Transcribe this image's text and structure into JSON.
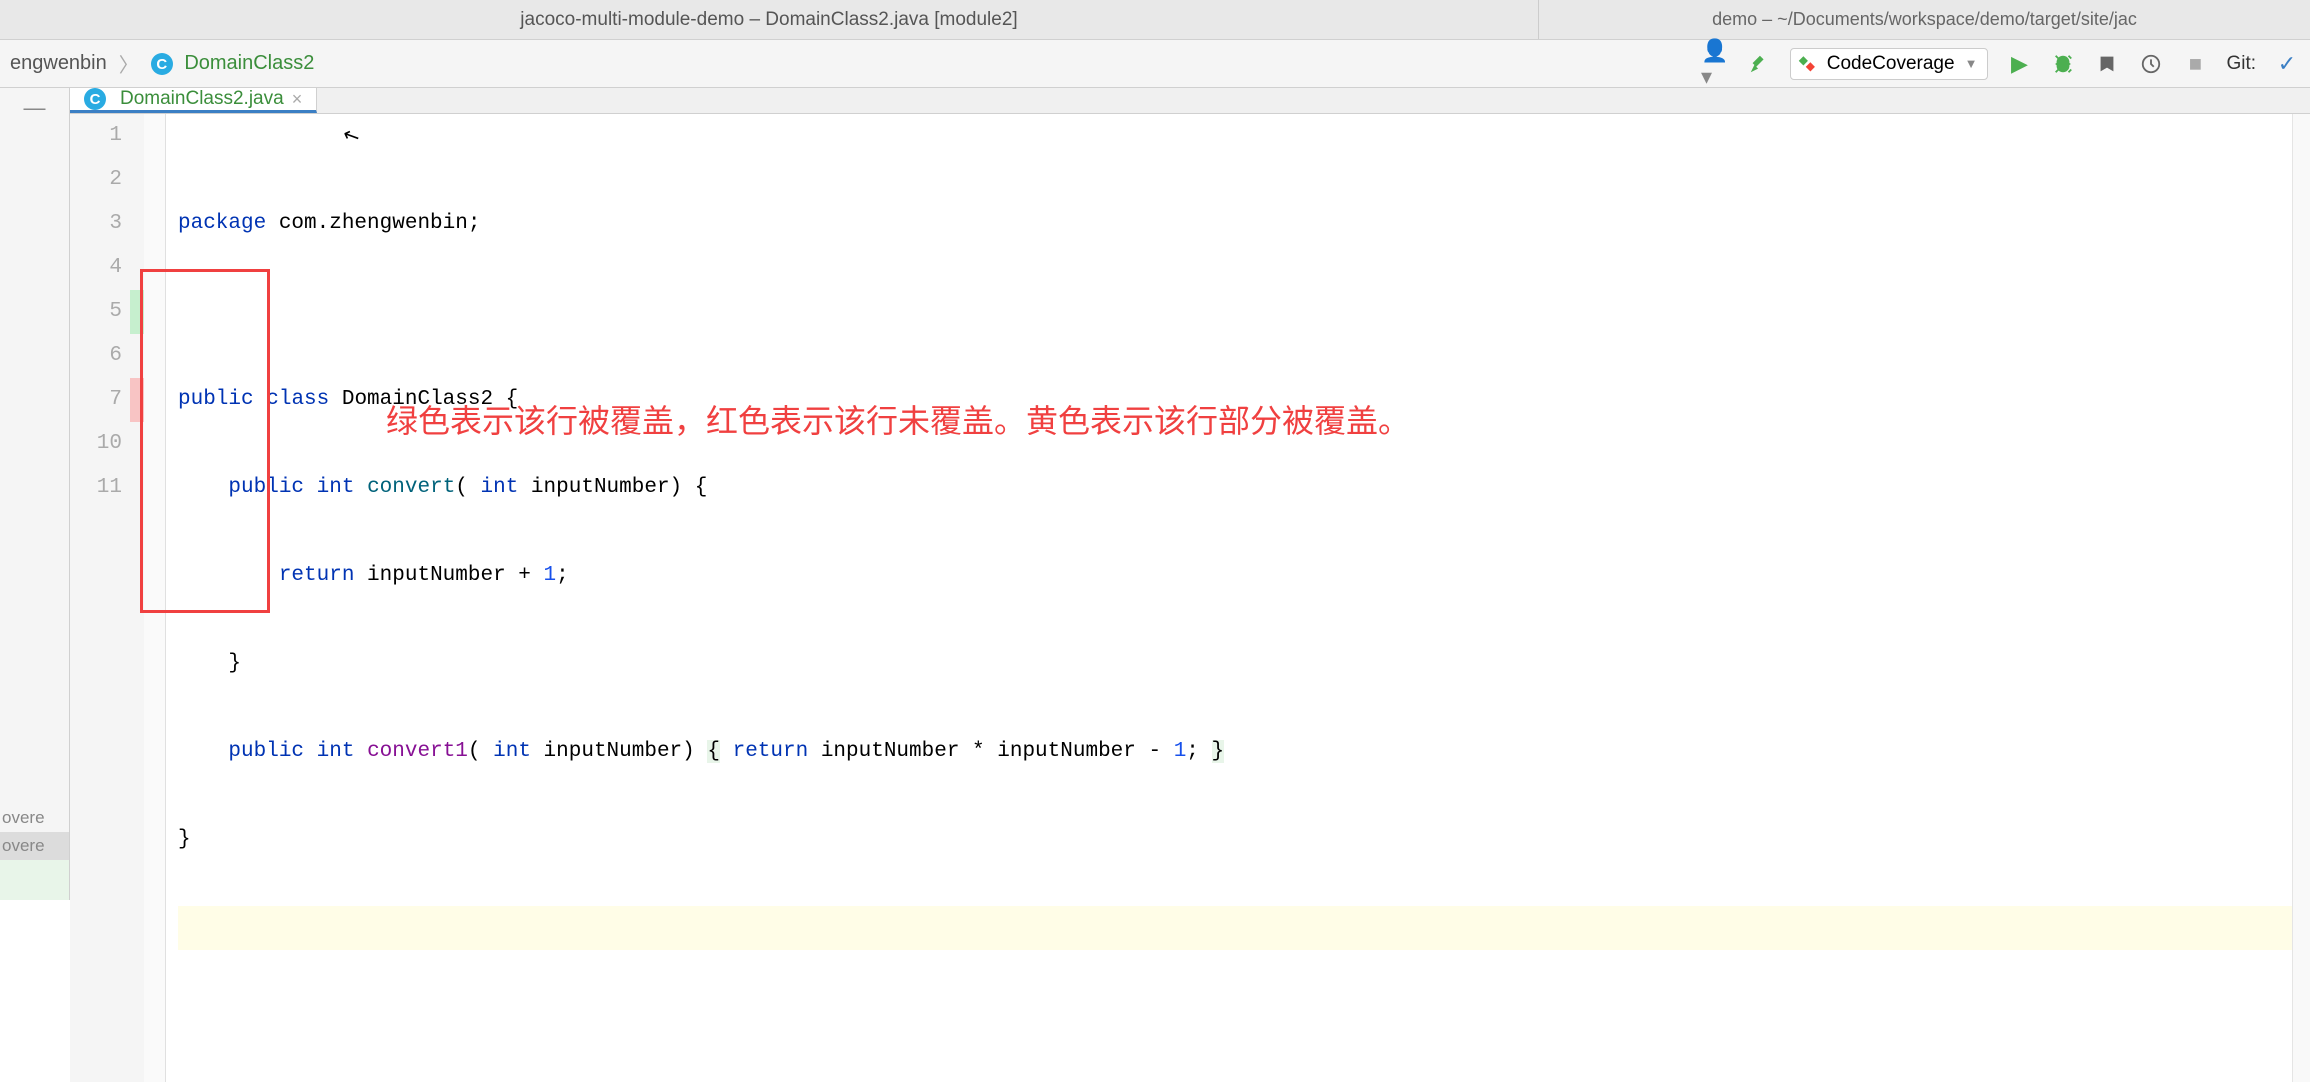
{
  "title": {
    "center": "jacoco-multi-module-demo – DomainClass2.java [module2]",
    "right": "demo – ~/Documents/workspace/demo/target/site/jac"
  },
  "breadcrumb": {
    "pkg": "engwenbin",
    "class": "DomainClass2"
  },
  "toolbar": {
    "run_config_label": "CodeCoverage",
    "git_label": "Git:"
  },
  "tab": {
    "label": "DomainClass2.java"
  },
  "gutter": {
    "lines": [
      "1",
      "2",
      "3",
      "4",
      "5",
      "6",
      "7",
      "10",
      "11"
    ]
  },
  "coverage": {
    "markers": [
      "none",
      "none",
      "none",
      "none",
      "green",
      "none",
      "red",
      "none",
      "none"
    ]
  },
  "code": {
    "l1_kw": "package",
    "l1_rest": " com.zhengwenbin;",
    "l3_kw1": "public",
    "l3_kw2": "class",
    "l3_name": " DomainClass2 {",
    "l4_kw1": "public",
    "l4_kw2": "int",
    "l4_method": "convert",
    "l4_sig_open": "( ",
    "l4_kw3": "int",
    "l4_sig_rest": " inputNumber) {",
    "l5_kw": "return",
    "l5_expr": " inputNumber + ",
    "l5_num": "1",
    "l5_end": ";",
    "l6": "    }",
    "l7_kw1": "public",
    "l7_kw2": "int",
    "l7_method": "convert1",
    "l7_sig_open": "( ",
    "l7_kw3": "int",
    "l7_sig_rest": " inputNumber) ",
    "l7_brace1": "{",
    "l7_kw4": "return",
    "l7_expr": " inputNumber * inputNumber - ",
    "l7_num": "1",
    "l7_end": "; ",
    "l7_brace2": "}",
    "l10": "}"
  },
  "annotation": "绿色表示该行被覆盖，红色表示该行未覆盖。黄色表示该行部分被覆盖。",
  "left_panel": {
    "item1": "overe",
    "item2": "overe"
  }
}
